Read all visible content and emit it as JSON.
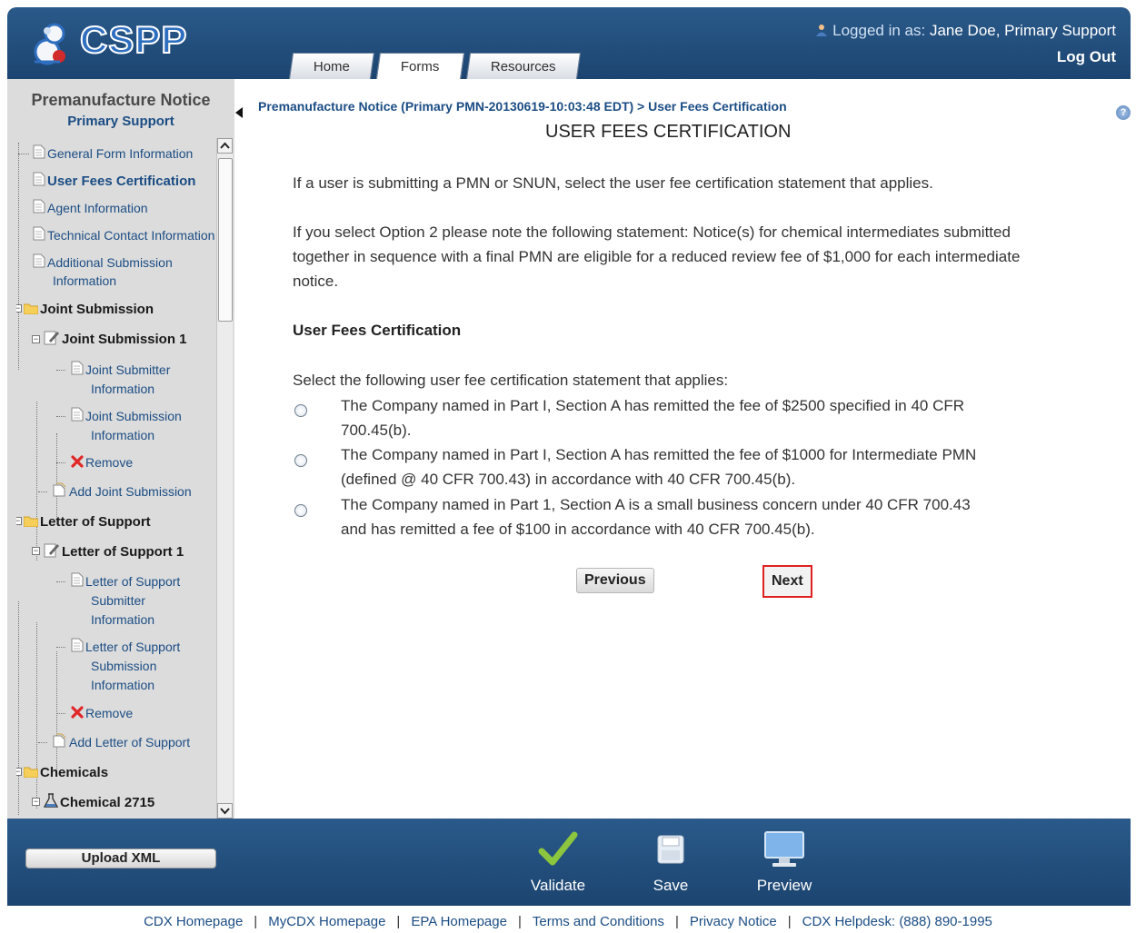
{
  "header": {
    "logo_text": "CSPP",
    "logged_in_label": "Logged in as:",
    "logged_in_user": "Jane Doe, Primary Support",
    "logout": "Log Out",
    "tabs": [
      {
        "label": "Home"
      },
      {
        "label": "Forms"
      },
      {
        "label": "Resources"
      }
    ]
  },
  "sidebar": {
    "title": "Premanufacture Notice",
    "subtitle": "Primary Support",
    "tree": {
      "general": "General Form Information",
      "user_fees": "User Fees Certification",
      "agent": "Agent Information",
      "technical": "Technical Contact Information",
      "additional_1": "Additional Submission",
      "additional_2": "Information",
      "joint_submission": "Joint Submission",
      "joint_submission_1": "Joint Submission 1",
      "joint_submitter_1": "Joint Submitter",
      "joint_submitter_2": "Information",
      "joint_subinfo_1": "Joint Submission",
      "joint_subinfo_2": "Information",
      "remove_1": "Remove",
      "add_joint": "Add Joint Submission",
      "letter_support": "Letter of Support",
      "letter_support_1": "Letter of Support 1",
      "los_submitter_1": "Letter of Support",
      "los_submitter_2": "Submitter",
      "los_submitter_3": "Information",
      "los_subinfo_1": "Letter of Support",
      "los_subinfo_2": "Submission",
      "los_subinfo_3": "Information",
      "remove_2": "Remove",
      "add_letter": "Add Letter of Support",
      "chemicals": "Chemicals",
      "chemical_2715": "Chemical 2715"
    }
  },
  "main": {
    "breadcrumb": "Premanufacture Notice (Primary PMN-20130619-10:03:48 EDT) > User Fees Certification",
    "title": "USER FEES CERTIFICATION",
    "help": "?",
    "intro": "If a user is submitting a PMN or SNUN, select the user fee certification statement that applies.",
    "note_line1": "If you select Option 2 please note the following statement: Notice(s) for chemical intermediates submitted",
    "note_line2": "together in sequence with a final PMN are eligible for a reduced review fee of $1,000 for each intermediate",
    "note_line3": "notice.",
    "section_heading": "User Fees Certification",
    "select_label": "Select the following user fee certification statement that applies:",
    "options": [
      {
        "line1": "The Company named in Part I, Section A has remitted the fee of $2500 specified in 40 CFR",
        "line2": "700.45(b)."
      },
      {
        "line1": "The Company named in Part I, Section A has remitted the fee of $1000 for Intermediate PMN",
        "line2": "(defined @ 40 CFR 700.43) in accordance with 40 CFR 700.45(b)."
      },
      {
        "line1": "The Company named in Part 1, Section A is a small business concern under 40 CFR 700.43",
        "line2": "and has remitted a fee of $100 in accordance with 40 CFR 700.45(b)."
      }
    ],
    "previous": "Previous",
    "next": "Next"
  },
  "footbar": {
    "upload": "Upload XML",
    "validate": "Validate",
    "save": "Save",
    "preview": "Preview"
  },
  "footer_links": {
    "cdx_home": "CDX Homepage",
    "mycdx_home": "MyCDX Homepage",
    "epa_home": "EPA Homepage",
    "terms": "Terms and Conditions",
    "privacy": "Privacy Notice",
    "helpdesk": "CDX Helpdesk: (888) 890-1995",
    "separator": "|"
  },
  "colors": {
    "header_bg": "#1c4470",
    "link": "#1b4d84",
    "next_highlight": "#e02020"
  }
}
